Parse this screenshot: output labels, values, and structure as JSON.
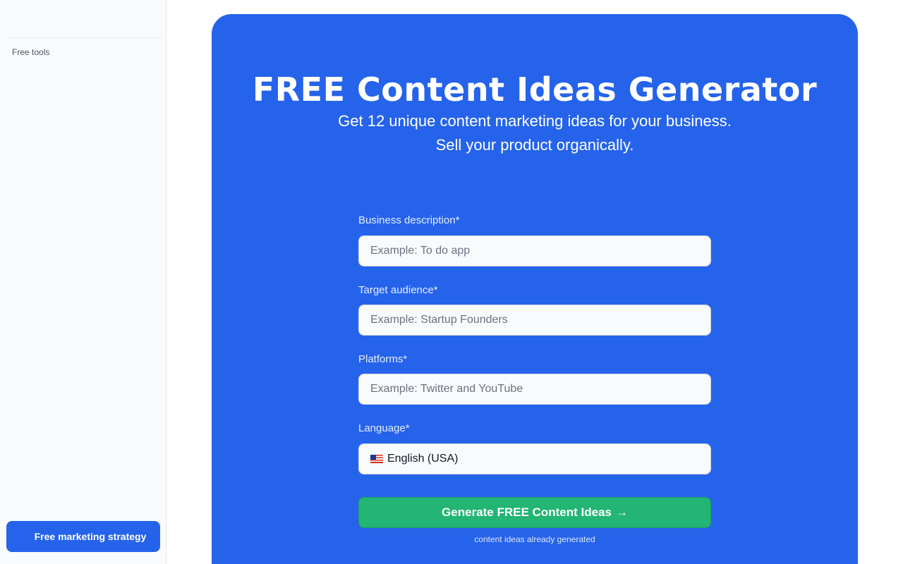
{
  "sidebar": {
    "section_label": "Free tools",
    "cta_label": "Free marketing strategy"
  },
  "hero": {
    "title": "FREE Content Ideas Generator",
    "subtitle_line1": "Get 12 unique content marketing ideas for your business.",
    "subtitle_line2": "Sell your product organically."
  },
  "form": {
    "business": {
      "label": "Business description*",
      "placeholder": "Example: To do app",
      "value": ""
    },
    "audience": {
      "label": "Target audience*",
      "placeholder": "Example: Startup Founders",
      "value": ""
    },
    "platforms": {
      "label": "Platforms*",
      "placeholder": "Example: Twitter and YouTube",
      "value": ""
    },
    "language": {
      "label": "Language*",
      "selected": "English (USA)",
      "flag_icon": "us-flag-icon"
    },
    "submit_label": "Generate FREE Content Ideas",
    "submit_icon": "arrow-right-icon",
    "footnote": "content ideas already generated"
  },
  "colors": {
    "primary": "#2563eb",
    "success": "#22b573",
    "sidebar_bg": "#f8fafc"
  }
}
